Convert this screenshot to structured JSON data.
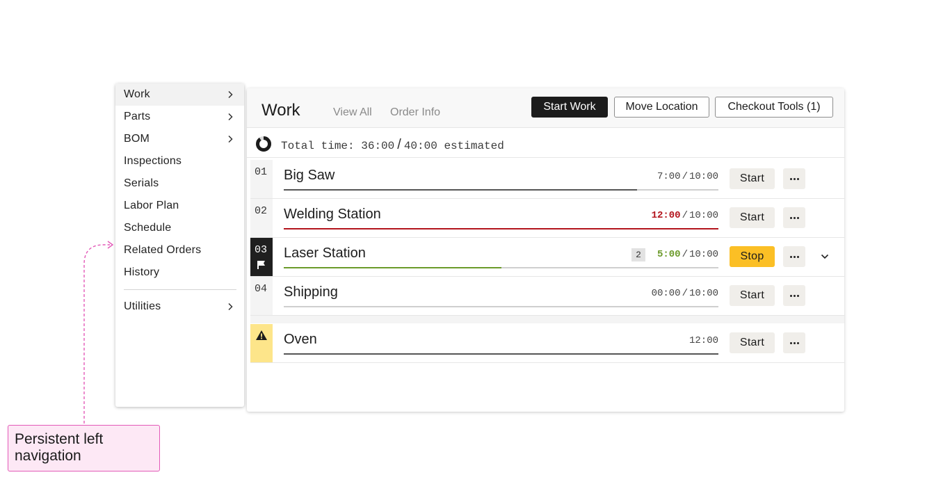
{
  "menu": {
    "items": [
      {
        "label": "Work",
        "chevron": true
      },
      {
        "label": "Parts",
        "chevron": true
      },
      {
        "label": "BOM",
        "chevron": true
      },
      {
        "label": "Inspections",
        "chevron": false
      },
      {
        "label": "Serials",
        "chevron": false
      },
      {
        "label": "Labor Plan",
        "chevron": false
      },
      {
        "label": "Schedule",
        "chevron": false
      },
      {
        "label": "Related Orders",
        "chevron": false
      },
      {
        "label": "History",
        "chevron": false
      }
    ],
    "utilities": {
      "label": "Utilities",
      "chevron": true
    }
  },
  "header": {
    "title": "Work",
    "view_all": "View All",
    "order_info": "Order Info",
    "start_work": "Start Work",
    "move_location": "Move Location",
    "checkout_tools": "Checkout Tools (1)"
  },
  "total": {
    "label": "Total time:",
    "actual": "36:00",
    "estimated": "40:00",
    "suffix": "estimated",
    "progress_fraction": 0.9
  },
  "operations": [
    {
      "num": "01",
      "name": "Big Saw",
      "time": "7:00",
      "estimate": "10:00",
      "status": "normal",
      "progress_fraction": 0.813,
      "action": "Start"
    },
    {
      "num": "02",
      "name": "Welding Station",
      "time": "12:00",
      "estimate": "10:00",
      "status": "over",
      "progress_fraction": 1.0,
      "action": "Start"
    },
    {
      "num": "03",
      "name": "Laser Station",
      "time": "5:00",
      "estimate": "10:00",
      "status": "running",
      "progress_fraction": 0.5,
      "action": "Stop",
      "badge": "2"
    },
    {
      "num": "04",
      "name": "Shipping",
      "time": "00:00",
      "estimate": "10:00",
      "status": "normal",
      "progress_fraction": 0.0,
      "action": "Start"
    }
  ],
  "extra_operation": {
    "name": "Oven",
    "time": "12:00",
    "action": "Start",
    "progress_fraction": 1.0
  },
  "annotation": {
    "text": "Persistent left navigation"
  },
  "colors": {
    "over": "#b3141c",
    "running": "#6b9a2a",
    "stop_button": "#fbbf25",
    "warning_bg": "#fde58a",
    "callout_border": "#e35ab8"
  }
}
